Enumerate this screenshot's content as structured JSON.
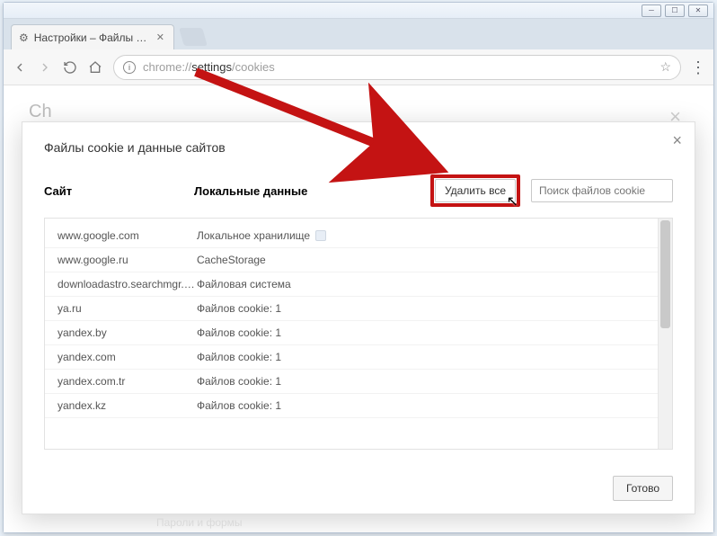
{
  "window": {
    "tab_title": "Настройки – Файлы coo",
    "url_prefix": "chrome://",
    "url_mid": "settings",
    "url_suffix": "/cookies"
  },
  "backdrop": {
    "partial": "Ch"
  },
  "modal": {
    "title": "Файлы cookie и данные сайтов",
    "col_site": "Сайт",
    "col_local": "Локальные данные",
    "delete_all": "Удалить все",
    "search_placeholder": "Поиск файлов cookie",
    "done": "Готово",
    "rows": [
      {
        "site": "www.google.com",
        "local": "Локальное хранилище",
        "storage_icon": true
      },
      {
        "site": "www.google.ru",
        "local": "CacheStorage"
      },
      {
        "site": "downloadastro.searchmgr.com",
        "local": "Файловая система"
      },
      {
        "site": "ya.ru",
        "local": "Файлов cookie: 1"
      },
      {
        "site": "yandex.by",
        "local": "Файлов cookie: 1"
      },
      {
        "site": "yandex.com",
        "local": "Файлов cookie: 1"
      },
      {
        "site": "yandex.com.tr",
        "local": "Файлов cookie: 1"
      },
      {
        "site": "yandex.kz",
        "local": "Файлов cookie: 1"
      }
    ]
  },
  "blurb": "Пароли и формы"
}
